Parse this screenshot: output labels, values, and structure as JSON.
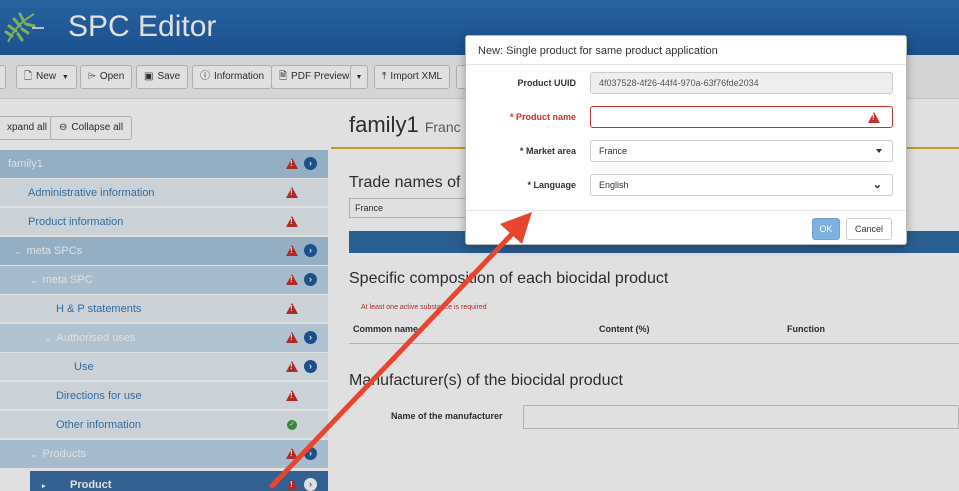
{
  "app": {
    "title": "SPC Editor",
    "brand_color": "#1f5ca0"
  },
  "toolbar": {
    "new_label": "New",
    "open_label": "Open",
    "save_label": "Save",
    "information_label": "Information",
    "pdf_preview_label": "PDF Preview",
    "import_xml_label": "Import XML"
  },
  "sidebar": {
    "expand_all_label": "xpand all",
    "collapse_all_label": "Collapse all",
    "tree": {
      "family": "family1",
      "administrative": "Administrative information",
      "product_info": "Product information",
      "meta_spcs": "meta SPCs",
      "meta_spc": "meta SPC",
      "hp_statements": "H & P statements",
      "authorised_uses": "Authorised uses",
      "use": "Use",
      "directions": "Directions for use",
      "other_info": "Other information",
      "products": "Products",
      "product": "Product"
    }
  },
  "main": {
    "title": "family1",
    "title_suffix": "Franc",
    "trade_names_title": "Trade names of t",
    "country_value": "France",
    "composition_title": "Specific composition of each biocidal product",
    "required_note": "At least one active substance is required",
    "table_headers": {
      "common_name": "Common name",
      "content": "Content (%)",
      "function": "Function"
    },
    "manufacturer_title": "Manufacturer(s) of the biocidal product",
    "manufacturer_label": "Name of the manufacturer"
  },
  "modal": {
    "title": "New: Single product for same product application",
    "uuid_label": "Product UUID",
    "uuid_value": "4f037528-4f26-44f4-970a-63f76fde2034",
    "name_label": "Product name",
    "name_value": "",
    "market_label": "Market area",
    "market_value": "France",
    "language_label": "Language",
    "language_value": "English",
    "required_marker": "*",
    "ok_label": "OK",
    "cancel_label": "Cancel"
  },
  "colors": {
    "error": "#c9302c",
    "arrow": "#e8452f",
    "selected": "#3a6ea5"
  }
}
